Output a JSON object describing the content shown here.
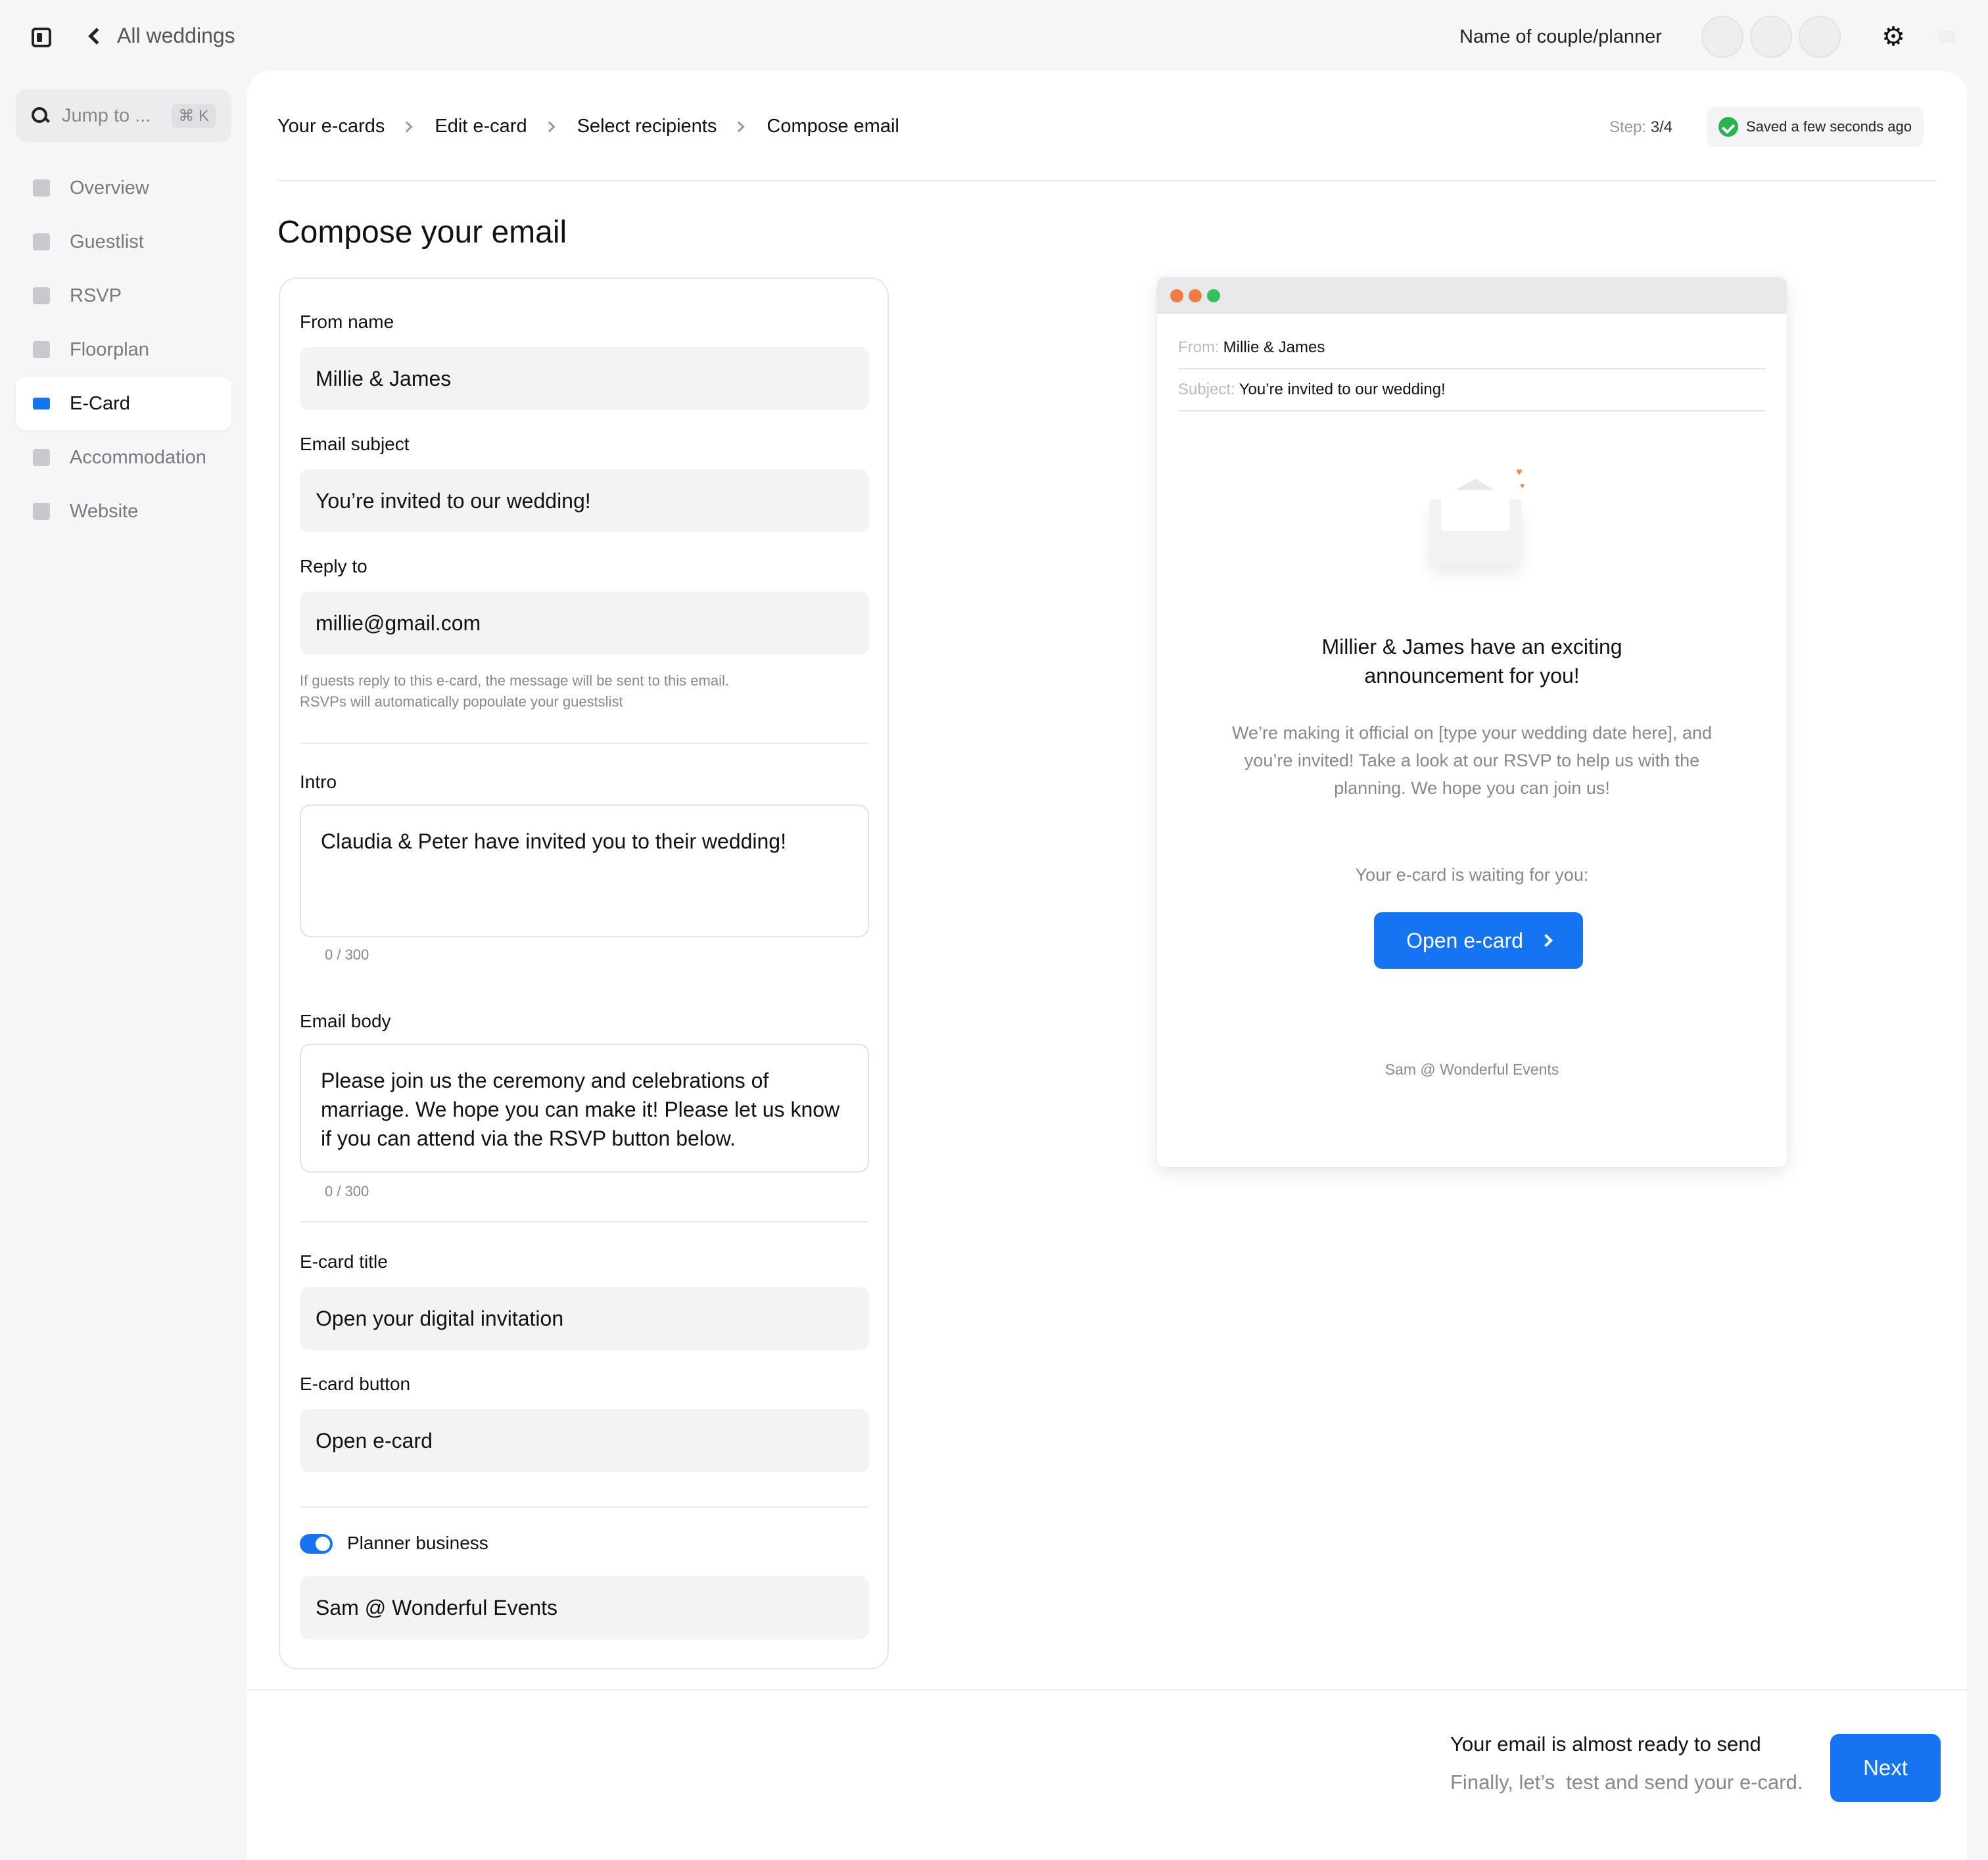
{
  "topbar": {
    "back_label": "All weddings",
    "couple_name": "Name of couple/planner",
    "icons": [
      "sidebar-toggle-icon",
      "chevron-left-icon",
      "gear-icon",
      "chat-icon"
    ]
  },
  "search": {
    "placeholder": "Jump to ...",
    "shortcut": "⌘ K"
  },
  "sidebar": {
    "items": [
      {
        "label": "Overview",
        "icon": "home-icon"
      },
      {
        "label": "Guestlist",
        "icon": "users-icon"
      },
      {
        "label": "RSVP",
        "icon": "rsvp-icon"
      },
      {
        "label": "Floorplan",
        "icon": "floorplan-icon"
      },
      {
        "label": "E-Card",
        "icon": "mail-icon",
        "active": true
      },
      {
        "label": "Accommodation",
        "icon": "bed-icon"
      },
      {
        "label": "Website",
        "icon": "laptop-icon"
      }
    ]
  },
  "breadcrumb": [
    "Your e-cards",
    "Edit e-card",
    "Select recipients",
    "Compose email"
  ],
  "step": {
    "label": "Step:",
    "value": "3/4"
  },
  "saved_status": "Saved a few seconds ago",
  "page_title": "Compose your email",
  "form": {
    "from_name": {
      "label": "From name",
      "value": "Millie & James"
    },
    "subject": {
      "label": "Email subject",
      "value": "You’re invited to our wedding!"
    },
    "reply_to": {
      "label": "Reply to",
      "value": "millie@gmail.com",
      "help_1": "If guests reply to this e-card, the message will be sent to this email.",
      "help_2": "RSVPs will automatically popoulate your guestslist"
    },
    "intro": {
      "label": "Intro",
      "value": "Claudia & Peter have invited you to their wedding!",
      "count": "0 / 300"
    },
    "body": {
      "label": "Email body",
      "value": "Please join us the ceremony and celebrations of marriage. We hope you can make it! Please let us know if you can attend via the RSVP button below.",
      "count": "0 / 300"
    },
    "ecard_title": {
      "label": "E-card title",
      "value": "Open your digital invitation"
    },
    "ecard_button": {
      "label": "E-card button",
      "value": "Open e-card"
    },
    "planner": {
      "label": "Planner business",
      "enabled": true,
      "value": "Sam @ Wonderful Events"
    }
  },
  "preview": {
    "from_key": "From:",
    "from_val": "Millie & James",
    "subject_key": "Subject:",
    "subject_val": "You’re invited to our wedding!",
    "heading_1": "Millier & James have an exciting",
    "heading_2": "announcement for you!",
    "body": "We’re making it official on [type your wedding date here], and you’re invited! Take a look at our RSVP to help us with the planning. We hope you can join us!",
    "waiting": "Your e-card is waiting for you:",
    "button": "Open e-card",
    "signature": "Sam @ Wonderful Events",
    "dot_colors": [
      "#ef7b45",
      "#ef7b45",
      "#34c05a"
    ]
  },
  "footer": {
    "title": "Your email is almost ready to send",
    "subtitle": "Finally, let’s  test and send your e-card.",
    "next": "Next"
  },
  "colors": {
    "accent": "#1674f2",
    "success": "#27b34d"
  }
}
